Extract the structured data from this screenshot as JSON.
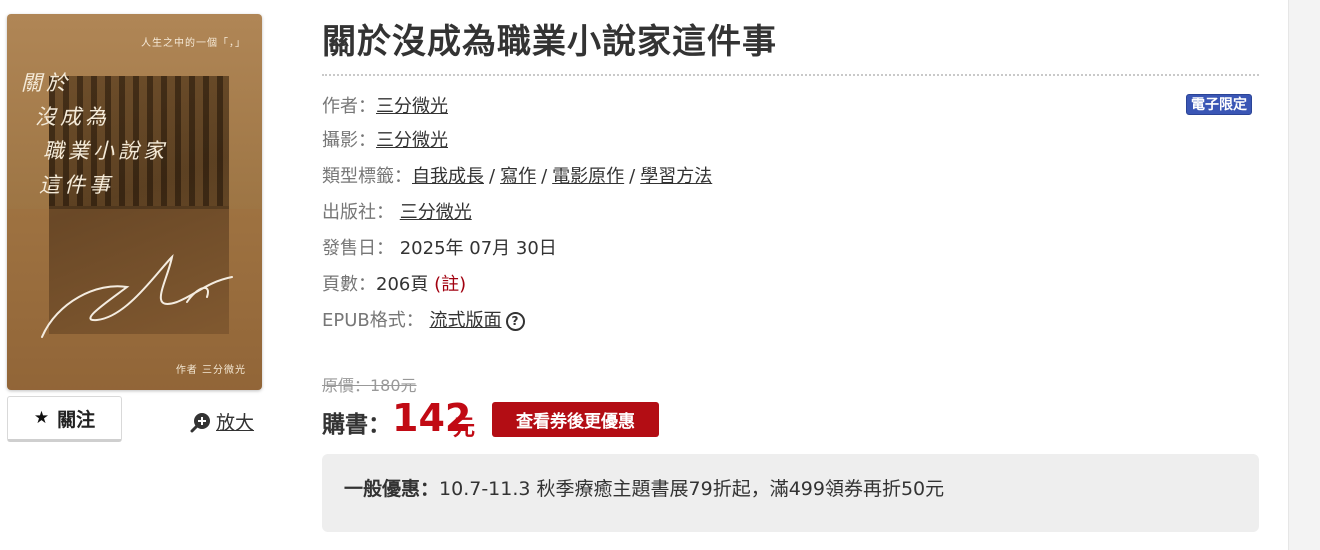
{
  "cover": {
    "tagline": "人生之中的一個「，」",
    "title_lines": [
      "關於",
      "沒成為",
      "職業小說家",
      "這件事"
    ],
    "author": "作者 三分微光"
  },
  "actions": {
    "follow_label": "關注",
    "follow_icon": "star-icon",
    "zoom_label": "放大",
    "zoom_icon": "zoom-in-icon"
  },
  "book": {
    "title": "關於沒成為職業小說家這件事",
    "badge": "電子限定",
    "author_label": "作者：",
    "author": "三分微光",
    "photo_label": "攝影：",
    "photographer": "三分微光",
    "tags_label": "類型標籤：",
    "tags": [
      "自我成長",
      "寫作",
      "電影原作",
      "學習方法"
    ],
    "tag_separator": "/",
    "publisher_label": "出版社：",
    "publisher": "三分微光",
    "release_label": "發售日：",
    "release_date": "2025年 07月 30日",
    "pages_label": "頁數：",
    "pages": "206頁",
    "pages_note": "(註)",
    "format_label": "EPUB格式：",
    "format": "流式版面",
    "format_help_icon": "question-circle-icon"
  },
  "pricing": {
    "original": "原價：180元",
    "buy_label": "購書：",
    "price": "142",
    "unit": "元",
    "coupon_button": "查看券後更優惠"
  },
  "promo": {
    "label": "一般優惠：",
    "text": "10.7-11.3 秋季療癒主題書展79折起，滿499領券再折50元"
  },
  "colors": {
    "price_red": "#c10a14",
    "coupon_bg": "#b30d14",
    "badge_blue": "#3a56b5",
    "note_red": "#a1000f"
  }
}
